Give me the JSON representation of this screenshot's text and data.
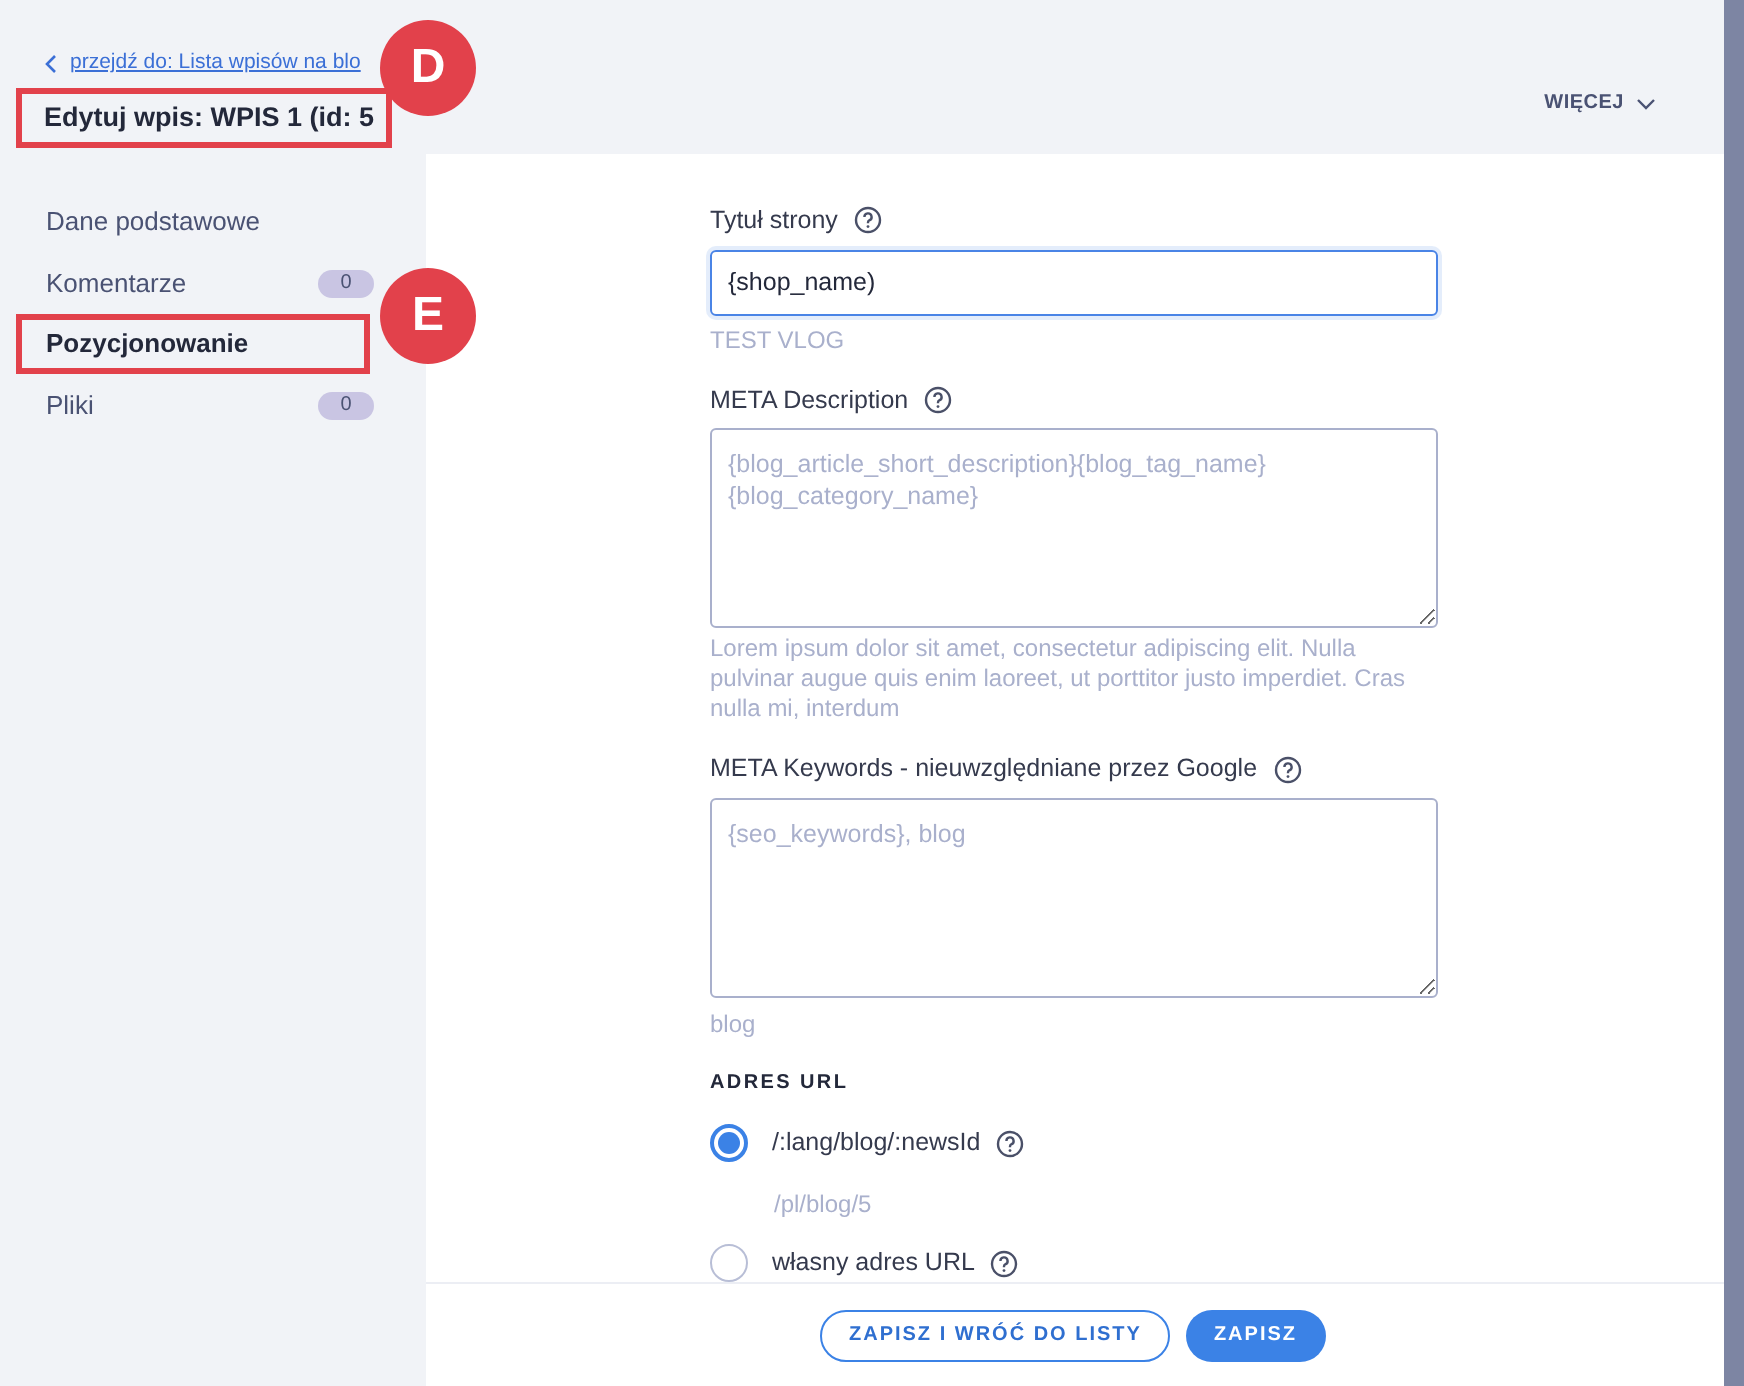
{
  "header": {
    "back_link": "przejdź do: Lista wpisów na blo",
    "title": "Edytuj wpis: WPIS 1 (id: 5",
    "more_menu": "WIĘCEJ"
  },
  "sidebar": {
    "items": [
      {
        "label": "Dane podstawowe",
        "selected": false
      },
      {
        "label": "Komentarze",
        "selected": false,
        "badge": "0"
      },
      {
        "label": "Pozycjonowanie",
        "selected": true
      },
      {
        "label": "Pliki",
        "selected": false,
        "badge": "0"
      }
    ]
  },
  "annotations": [
    {
      "label": "D"
    },
    {
      "label": "E"
    }
  ],
  "form": {
    "page_title": {
      "label": "Tytuł strony",
      "value": "{shop_name)",
      "hint": "TEST VLOG"
    },
    "meta_description": {
      "label": "META Description",
      "placeholder": "{blog_article_short_description}{blog_tag_name}\n{blog_category_name}",
      "hint": "Lorem ipsum dolor sit amet, consectetur adipiscing elit. Nulla pulvinar augue quis enim laoreet, ut porttitor justo imperdiet. Cras nulla mi, interdum"
    },
    "meta_keywords": {
      "label": "META Keywords - nieuwzględniane przez Google",
      "placeholder": "{seo_keywords}, blog",
      "hint": "blog"
    },
    "url": {
      "heading": "ADRES URL",
      "options": [
        {
          "label": "/:lang/blog/:newsId",
          "selected": true,
          "hint": "/pl/blog/5"
        },
        {
          "label": "własny adres URL",
          "selected": false
        }
      ]
    }
  },
  "footer": {
    "buttons": [
      {
        "label": "ZAPISZ I WRÓĆ DO LISTY",
        "kind": "outline"
      },
      {
        "label": "ZAPISZ",
        "kind": "primary"
      }
    ]
  }
}
